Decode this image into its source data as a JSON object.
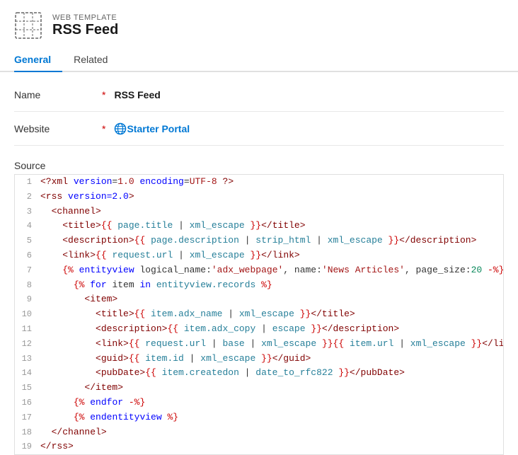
{
  "header": {
    "subtitle": "WEB TEMPLATE",
    "title": "RSS Feed"
  },
  "tabs": [
    {
      "id": "general",
      "label": "General",
      "active": true
    },
    {
      "id": "related",
      "label": "Related",
      "active": false
    }
  ],
  "form": {
    "name_label": "Name",
    "name_required": "*",
    "name_value": "RSS Feed",
    "website_label": "Website",
    "website_required": "*",
    "website_link_text": "Starter Portal"
  },
  "source": {
    "label": "Source"
  },
  "code_lines": [
    {
      "num": 1,
      "content": "<?xml version=1.0 encoding=UTF-8 ?>"
    },
    {
      "num": 2,
      "content": "<rss version=2.0>"
    },
    {
      "num": 3,
      "content": "  <channel>"
    },
    {
      "num": 4,
      "content": "    <title>{{ page.title | xml_escape }}</title>"
    },
    {
      "num": 5,
      "content": "    <description>{{ page.description | strip_html | xml_escape }}</description>"
    },
    {
      "num": 6,
      "content": "    <link>{{ request.url | xml_escape }}</link>"
    },
    {
      "num": 7,
      "content": "    {% entityview logical_name:'adx_webpage', name:'News Articles', page_size:20 -%}"
    },
    {
      "num": 8,
      "content": "      {% for item in entityview.records %}"
    },
    {
      "num": 9,
      "content": "        <item>"
    },
    {
      "num": 10,
      "content": "          <title>{{ item.adx_name | xml_escape }}</title>"
    },
    {
      "num": 11,
      "content": "          <description>{{ item.adx_copy | escape }}</description>"
    },
    {
      "num": 12,
      "content": "          <link>{{ request.url | base | xml_escape }}{{ item.url | xml_escape }}</link>"
    },
    {
      "num": 13,
      "content": "          <guid>{{ item.id | xml_escape }}</guid>"
    },
    {
      "num": 14,
      "content": "          <pubDate>{{ item.createdon | date_to_rfc822 }}</pubDate>"
    },
    {
      "num": 15,
      "content": "        </item>"
    },
    {
      "num": 16,
      "content": "      {% endfor -%}"
    },
    {
      "num": 17,
      "content": "      {% endentityview %}"
    },
    {
      "num": 18,
      "content": "  </channel>"
    },
    {
      "num": 19,
      "content": "</rss>"
    }
  ]
}
